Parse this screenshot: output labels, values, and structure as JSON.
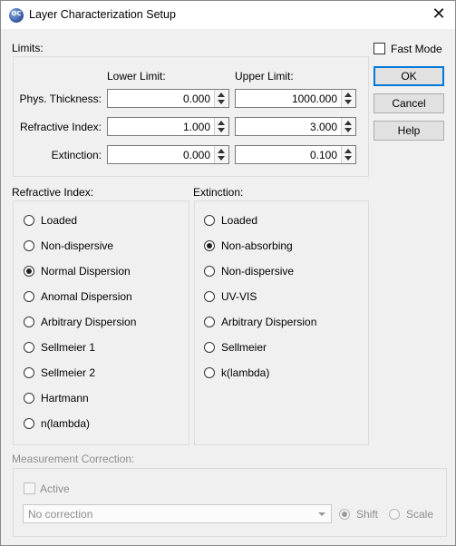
{
  "window": {
    "title": "Layer Characterization Setup",
    "icon_text": "OC"
  },
  "limits": {
    "label": "Limits:",
    "lower_header": "Lower Limit:",
    "upper_header": "Upper Limit:",
    "rows": [
      {
        "label": "Phys. Thickness:",
        "lower": "0.000",
        "upper": "1000.000"
      },
      {
        "label": "Refractive Index:",
        "lower": "1.000",
        "upper": "3.000"
      },
      {
        "label": "Extinction:",
        "lower": "0.000",
        "upper": "0.100"
      }
    ]
  },
  "fast_mode": {
    "label": "Fast Mode",
    "checked": false
  },
  "buttons": {
    "ok": "OK",
    "cancel": "Cancel",
    "help": "Help"
  },
  "refractive_index": {
    "label": "Refractive Index:",
    "options": [
      "Loaded",
      "Non-dispersive",
      "Normal Dispersion",
      "Anomal Dispersion",
      "Arbitrary Dispersion",
      "Sellmeier 1",
      "Sellmeier 2",
      "Hartmann",
      "n(lambda)"
    ],
    "selected": "Normal Dispersion"
  },
  "extinction": {
    "label": "Extinction:",
    "options": [
      "Loaded",
      "Non-absorbing",
      "Non-dispersive",
      "UV-VIS",
      "Arbitrary Dispersion",
      "Sellmeier",
      "k(lambda)"
    ],
    "selected": "Non-absorbing"
  },
  "measurement_correction": {
    "label": "Measurement Correction:",
    "active_label": "Active",
    "active_checked": false,
    "correction_value": "No correction",
    "shift_label": "Shift",
    "scale_label": "Scale",
    "mode_selected": "Shift"
  }
}
